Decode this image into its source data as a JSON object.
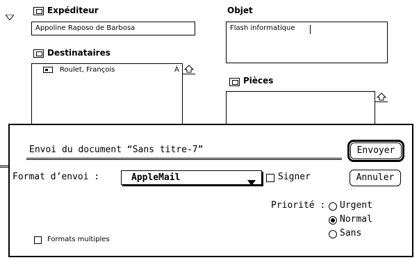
{
  "message": {
    "sender_label": "Expéditeur",
    "sender_value": "Appoline Raposo de Barbosa",
    "subject_label": "Objet",
    "subject_value": "Flash informatique",
    "recipients_label": "Destinataires",
    "recipients": [
      {
        "name": "Roulet, François",
        "marker": "À"
      }
    ],
    "attachments_label": "Pièces"
  },
  "dialog": {
    "title": "Envoi du document “Sans titre-7”",
    "send_button": "Envoyer",
    "cancel_button": "Annuler",
    "format_label": "Format d’envoi :",
    "format_selected": "AppleMail",
    "sign_label": "Signer",
    "priority_label": "Priorité :",
    "priority_options": [
      "Urgent",
      "Normal",
      "Sans"
    ],
    "priority_selected": "Normal",
    "multiple_formats_label": "Formats multiples"
  }
}
